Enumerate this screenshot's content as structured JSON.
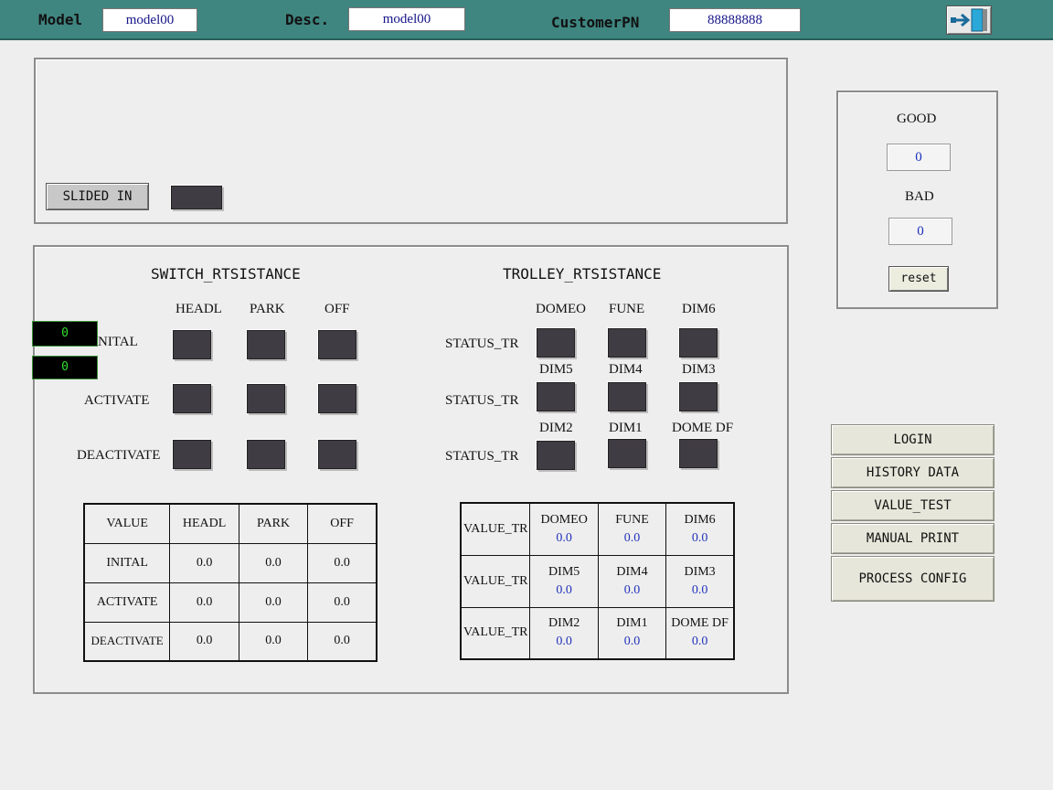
{
  "header": {
    "model_label": "Model",
    "model_value": "model00",
    "desc_label": "Desc.",
    "desc_value": "model00",
    "customer_pn_label": "CustomerPN",
    "customer_pn_value": "88888888",
    "exit_icon": "exit-door-icon"
  },
  "top_panel": {
    "slided_in_label": "SLIDED IN"
  },
  "counters": {
    "good_label": "GOOD",
    "good_value": "0",
    "bad_label": "BAD",
    "bad_value": "0",
    "reset_label": "reset"
  },
  "switch": {
    "title": "SWITCH_RTSISTANCE",
    "columns": [
      "HEADL",
      "PARK",
      "OFF"
    ],
    "rows": [
      "INITAL",
      "ACTIVATE",
      "DEACTIVATE"
    ],
    "overlay_values": [
      "0",
      "0"
    ],
    "table": {
      "corner": "VALUE",
      "headers": [
        "HEADL",
        "PARK",
        "OFF"
      ],
      "rows": [
        {
          "label": "INITAL",
          "values": [
            "0.0",
            "0.0",
            "0.0"
          ]
        },
        {
          "label": "ACTIVATE",
          "values": [
            "0.0",
            "0.0",
            "0.0"
          ]
        },
        {
          "label": "DEACTIVATE",
          "values": [
            "0.0",
            "0.0",
            "0.0"
          ]
        }
      ]
    }
  },
  "trolley": {
    "title": "TROLLEY_RTSISTANCE",
    "row_label": "STATUS_TR",
    "groups": [
      [
        "DOMEO",
        "FUNE",
        "DIM6"
      ],
      [
        "DIM5",
        "DIM4",
        "DIM3"
      ],
      [
        "DIM2",
        "DIM1",
        "DOME DF"
      ]
    ],
    "table": {
      "row_label": "VALUE_TR",
      "rows": [
        {
          "names": [
            "DOMEO",
            "FUNE",
            "DIM6"
          ],
          "values": [
            "0.0",
            "0.0",
            "0.0"
          ]
        },
        {
          "names": [
            "DIM5",
            "DIM4",
            "DIM3"
          ],
          "values": [
            "0.0",
            "0.0",
            "0.0"
          ]
        },
        {
          "names": [
            "DIM2",
            "DIM1",
            "DOME DF"
          ],
          "values": [
            "0.0",
            "0.0",
            "0.0"
          ]
        }
      ]
    }
  },
  "menu": {
    "login": "LOGIN",
    "history_data": "HISTORY DATA",
    "value_test": "VALUE_TEST",
    "manual_print": "MANUAL PRINT",
    "process_config": "PROCESS CONFIG"
  },
  "colors": {
    "header_bg": "#3f8580",
    "indicator": "#403c43",
    "value_text": "#2233bb",
    "led_text": "#33dd33"
  }
}
